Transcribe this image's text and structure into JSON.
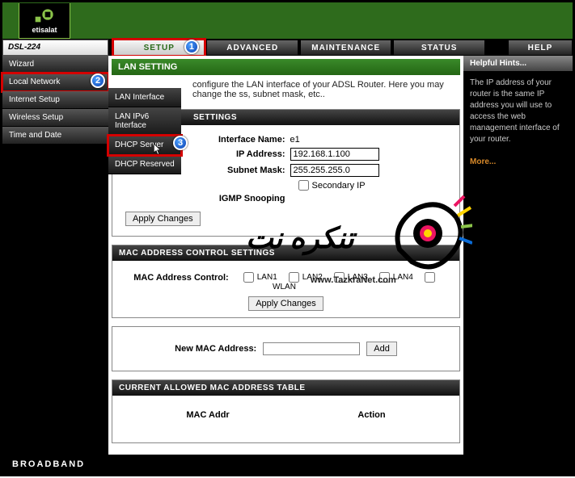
{
  "brand": {
    "name": "etisalat",
    "model": "DSL-224"
  },
  "tabs": {
    "setup": "SETUP",
    "advanced": "ADVANCED",
    "maintenance": "MAINTENANCE",
    "status": "STATUS",
    "help": "HELP"
  },
  "sidebar": {
    "items": [
      "Wizard",
      "Local Network",
      "Internet Setup",
      "Wireless Setup",
      "Time and Date"
    ]
  },
  "submenu": {
    "items": [
      "LAN Interface",
      "LAN IPv6 Interface",
      "DHCP Server",
      "DHCP Reserved"
    ]
  },
  "section": {
    "title": "LAN SETTING",
    "desc": "configure the LAN interface of your ADSL Router. Here you may change the ss, subnet mask, etc.."
  },
  "settings_panel": {
    "title": "SETTINGS",
    "iface_label": "Interface Name:",
    "iface_value": "e1",
    "ip_label": "IP Address:",
    "ip_value": "192.168.1.100",
    "mask_label": "Subnet Mask:",
    "mask_value": "255.255.255.0",
    "secondary_label": "Secondary IP",
    "igmp_label": "IGMP Snooping",
    "apply": "Apply Changes"
  },
  "mac_panel": {
    "title": "MAC ADDRESS CONTROL SETTINGS",
    "control_label": "MAC Address Control:",
    "opts": [
      "LAN1",
      "LAN2",
      "LAN3",
      "LAN4",
      "WLAN"
    ],
    "apply": "Apply Changes"
  },
  "newmac": {
    "label": "New MAC Address:",
    "value": "",
    "add": "Add"
  },
  "mac_table": {
    "title": "CURRENT ALLOWED MAC ADDRESS TABLE",
    "col1": "MAC Addr",
    "col2": "Action"
  },
  "help": {
    "title": "Helpful Hints...",
    "body": "The IP address of your router is the same IP address you will use to access the web management interface of your router.",
    "more": "More..."
  },
  "footer": "BROADBAND",
  "watermark": {
    "url": "www.TazkraNet.com",
    "script": "تنكره نت"
  },
  "badges": {
    "b1": "1",
    "b2": "2",
    "b3": "3"
  }
}
